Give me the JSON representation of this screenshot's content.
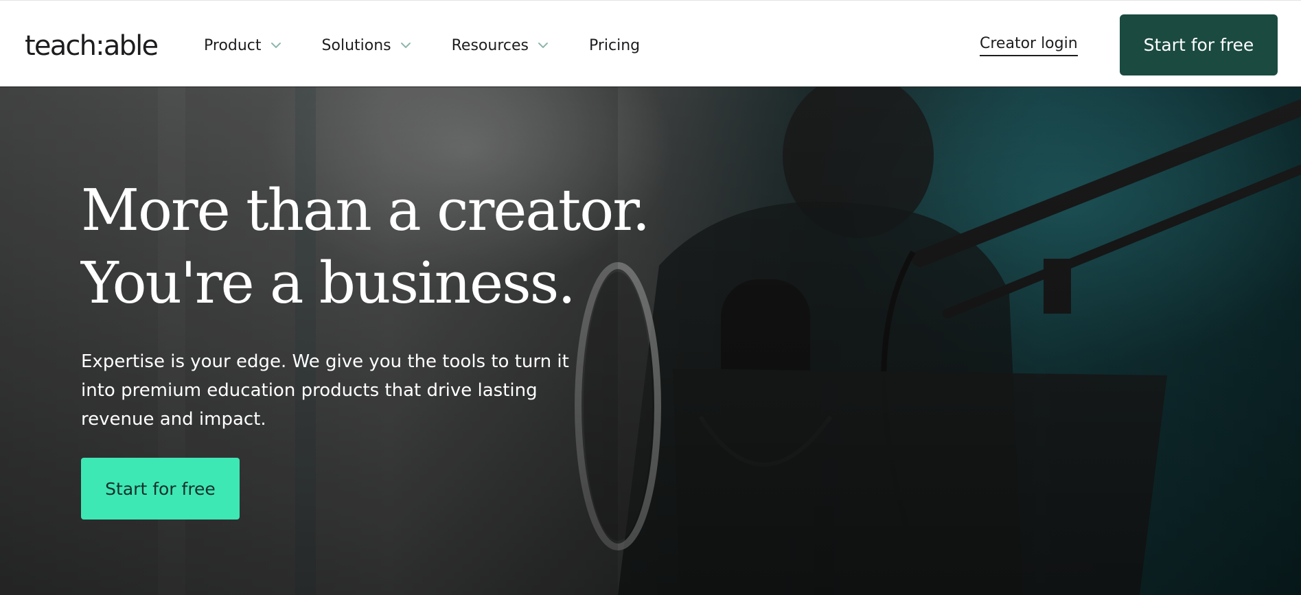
{
  "header": {
    "logo_text": "teach:able",
    "nav": [
      {
        "label": "Product",
        "icon": "chevron-down-icon"
      },
      {
        "label": "Solutions",
        "icon": "chevron-down-icon"
      },
      {
        "label": "Resources",
        "icon": "chevron-down-icon"
      },
      {
        "label": "Pricing"
      }
    ],
    "login_label": "Creator login",
    "cta_label": "Start for free"
  },
  "hero": {
    "title_line1": "More than a creator.",
    "title_line2": "You're a business.",
    "subtitle": "Expertise is your edge. We give you the tools to turn it into premium education products that drive lasting revenue and impact.",
    "cta_label": "Start for free"
  },
  "colors": {
    "primary_dark_green": "#1b4a40",
    "accent_mint": "#3de8b5",
    "text_dark": "#1d1d1f"
  }
}
